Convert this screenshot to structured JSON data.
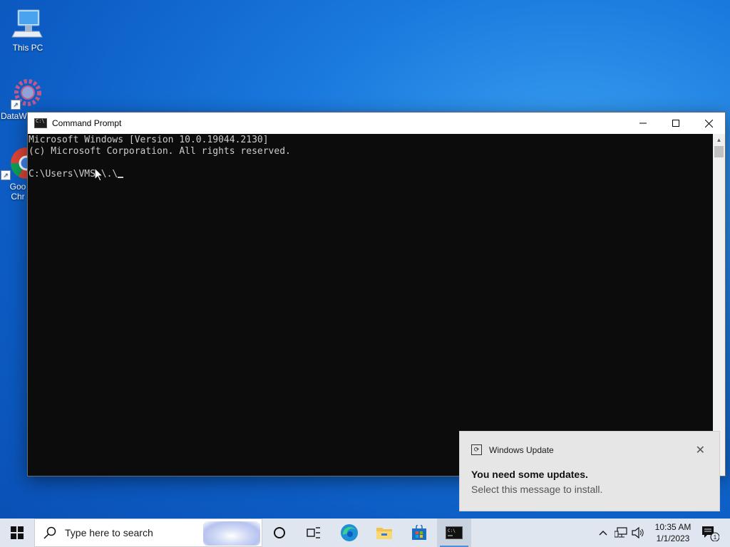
{
  "desktop": {
    "icons": [
      {
        "label": "This PC"
      },
      {
        "label": "DataW"
      },
      {
        "label": "Goo Chr"
      }
    ]
  },
  "window": {
    "title": "Command Prompt",
    "console_lines": [
      "Microsoft Windows [Version 10.0.19044.2130]",
      "(c) Microsoft Corporation. All rights reserved.",
      "",
      "C:\\Users\\VMS\\\\.\\"
    ]
  },
  "toast": {
    "app_name": "Windows Update",
    "heading": "You need some updates.",
    "body": "Select this message to install."
  },
  "taskbar": {
    "search_placeholder": "Type here to search",
    "time": "10:35 AM",
    "date": "1/1/2023",
    "notification_count": "1"
  }
}
